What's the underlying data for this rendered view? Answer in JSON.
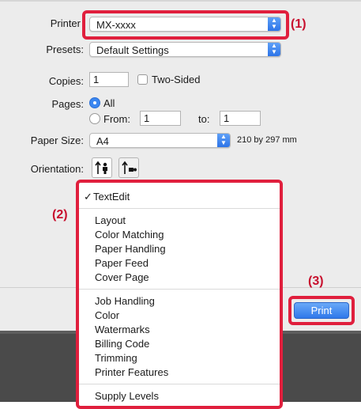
{
  "printer": {
    "label": "Printer",
    "value": "MX-xxxx"
  },
  "presets": {
    "label": "Presets:",
    "value": "Default Settings"
  },
  "copies": {
    "label": "Copies:",
    "value": "1",
    "two_sided": "Two-Sided"
  },
  "pages": {
    "label": "Pages:",
    "all": "All",
    "from": "From:",
    "from_value": "1",
    "to": "to:",
    "to_value": "1"
  },
  "paper_size": {
    "label": "Paper Size:",
    "value": "A4",
    "dimensions": "210 by 297 mm"
  },
  "orientation": {
    "label": "Orientation:"
  },
  "menu": {
    "checked_mark": "✓",
    "group1": [
      "TextEdit"
    ],
    "group2": [
      "Layout",
      "Color Matching",
      "Paper Handling",
      "Paper Feed",
      "Cover Page"
    ],
    "group3": [
      "Job Handling",
      "Color",
      "Watermarks",
      "Billing Code",
      "Trimming",
      "Printer Features"
    ],
    "group4": [
      "Supply Levels"
    ]
  },
  "callouts": {
    "c1": "(1)",
    "c2": "(2)",
    "c3": "(3)"
  },
  "print_button": "Print",
  "colors": {
    "callout": "#e01f3d",
    "accent": "#3b86f0"
  }
}
